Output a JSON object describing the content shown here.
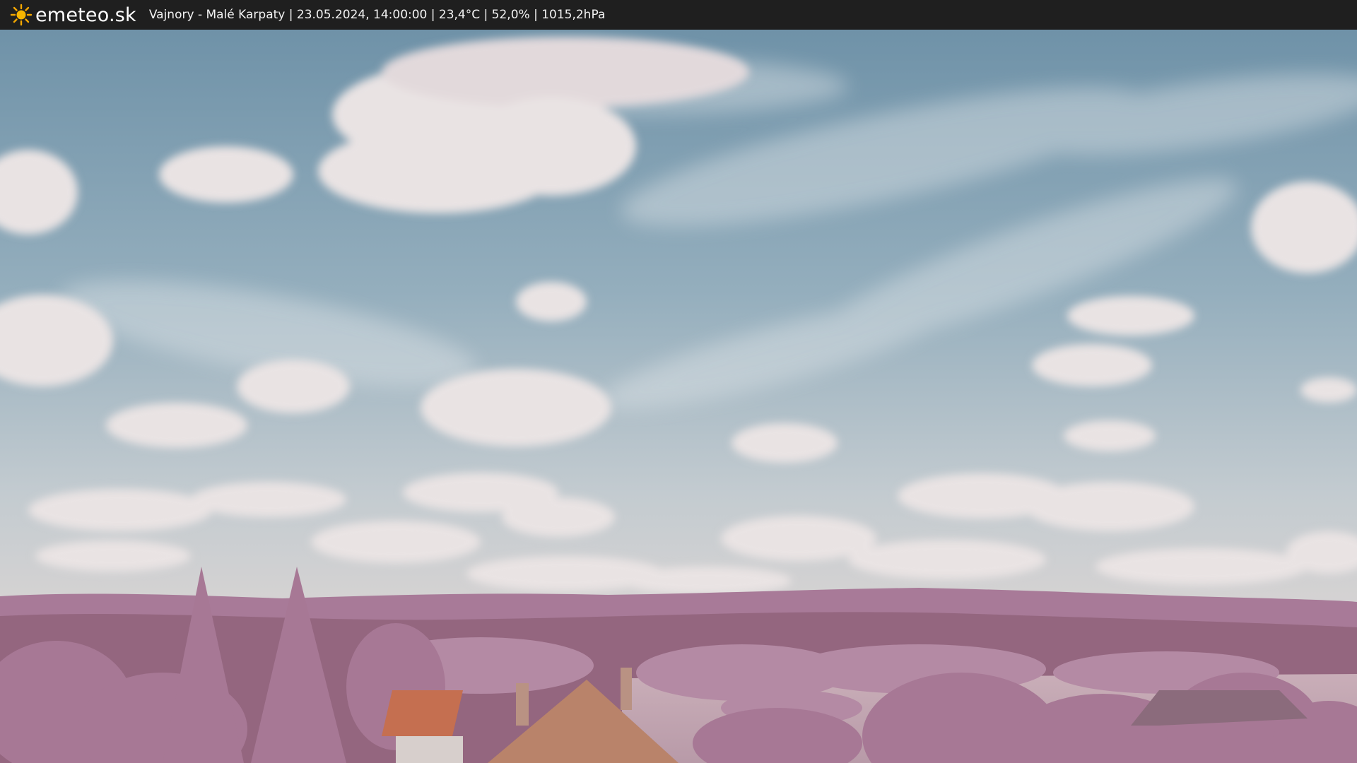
{
  "header": {
    "logo_icon": "sun-icon",
    "brand": "emeteo.sk",
    "caption": "Vajnory - Malé Karpaty | 23.05.2024, 14:00:00 | 23,4°C | 52,0% | 1015,2hPa"
  },
  "colors": {
    "bar": "#1f1f1f",
    "sun": "#f5a800",
    "sky_top": "#6f92a8",
    "sky_bottom": "#c8cdd0",
    "foliage": "#b889a8",
    "roof": "#b96a4a"
  }
}
